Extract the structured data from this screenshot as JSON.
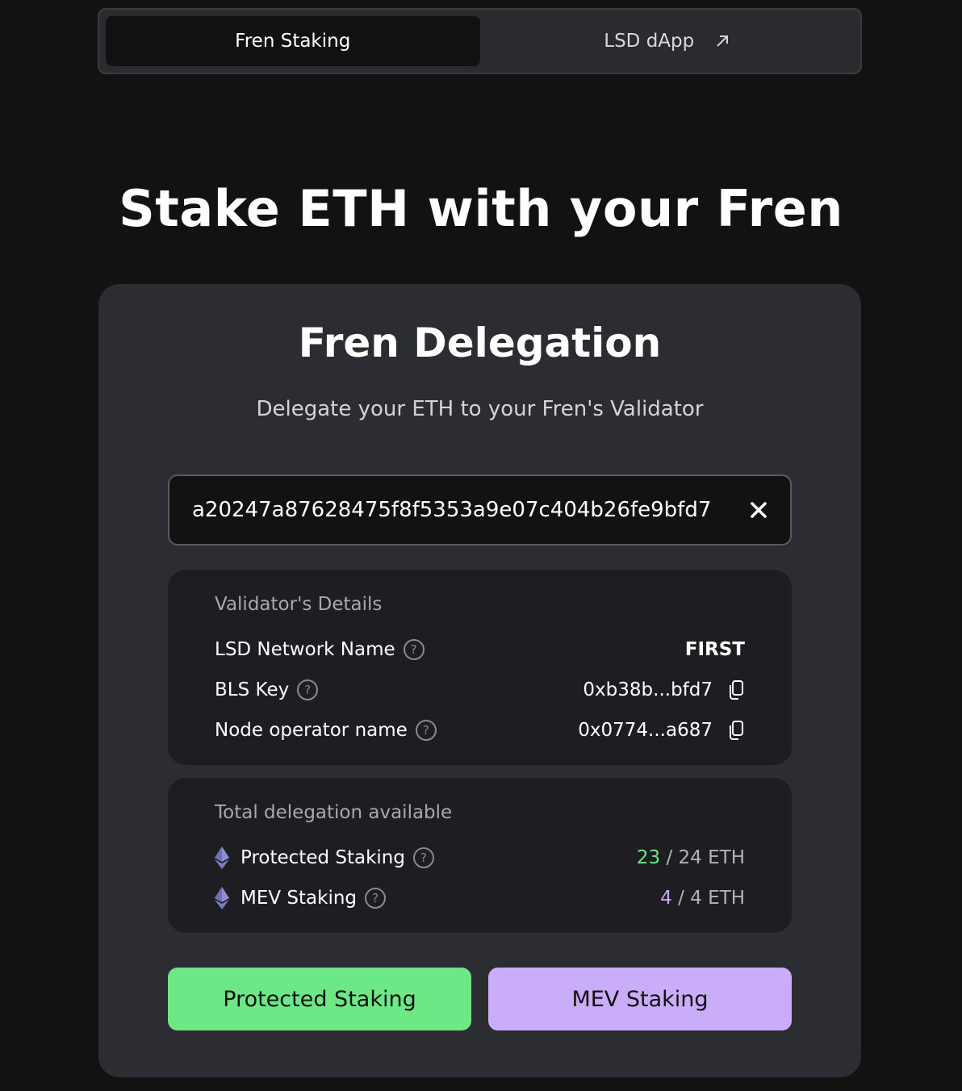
{
  "tabs": [
    {
      "label": "Fren Staking",
      "active": true
    },
    {
      "label": "LSD dApp",
      "icon": "external-link-icon",
      "active": false
    }
  ],
  "hero": {
    "title": "Stake ETH with your Fren"
  },
  "card": {
    "title": "Fren Delegation",
    "subtitle": "Delegate your ETH to your Fren's Validator",
    "bls_input": {
      "value": "a20247a87628475f8f5353a9e07c404b26fe9bfd7",
      "clear_icon": "close-icon"
    },
    "validator_details": {
      "title": "Validator's Details",
      "rows": [
        {
          "label": "LSD Network Name",
          "value": "FIRST",
          "help": "?"
        },
        {
          "label": "BLS Key",
          "value": "0xb38b...bfd7",
          "help": "?",
          "icon": "copy-icon"
        },
        {
          "label": "Node operator name",
          "value": "0x0774...a687",
          "help": "?",
          "icon": "copy-icon"
        }
      ]
    },
    "delegation": {
      "title": "Total delegation available",
      "rows": [
        {
          "label": "Protected Staking",
          "help": "?",
          "icon": "ethereum-icon",
          "current": "23",
          "separator": " / ",
          "total": "24 ETH"
        },
        {
          "label": "MEV Staking",
          "help": "?",
          "icon": "ethereum-icon",
          "current": "4",
          "separator": " / ",
          "total": "4 ETH"
        }
      ]
    },
    "buttons": {
      "protected": "Protected Staking",
      "mev": "MEV Staking"
    }
  },
  "colors": {
    "green_accent": "#6de886",
    "purple_accent": "#c9adf8",
    "background": "#121212",
    "card": "#2c2d33",
    "panel": "#1e1e22"
  }
}
